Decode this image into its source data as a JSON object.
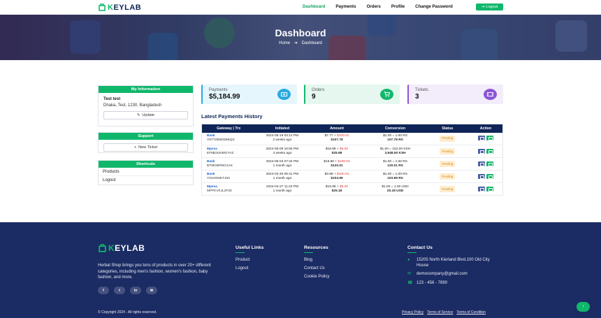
{
  "brand": {
    "name_k": "K",
    "name_rest": "EYLAB"
  },
  "nav": {
    "items": [
      {
        "label": "Dashboard",
        "active": true
      },
      {
        "label": "Payments",
        "active": false
      },
      {
        "label": "Orders",
        "active": false
      },
      {
        "label": "Profile",
        "active": false
      },
      {
        "label": "Change Password",
        "active": false
      }
    ],
    "logout_label": "Logout"
  },
  "banner": {
    "title": "Dashboard",
    "breadcrumb_home": "Home",
    "breadcrumb_current": "Dashboard"
  },
  "sidebar": {
    "info_title": "My Information",
    "user_name": "Test test",
    "user_address": "Dhaka, Test, 1230, Bangladesh",
    "update_label": "Update",
    "support_title": "Support",
    "new_ticket_label": "New Ticket",
    "shortcuts_title": "Shortcuts",
    "shortcuts": [
      "Products",
      "Logout"
    ]
  },
  "stats": [
    {
      "label": "Payments",
      "value": "$5,184.99",
      "bg": "#e6f6fd",
      "border": "#2aa9e0",
      "icon_bg": "#2aa9e0",
      "icon": "money-icon"
    },
    {
      "label": "Orders",
      "value": "9",
      "bg": "#e5f7ef",
      "border": "#10b76b",
      "icon_bg": "#10b76b",
      "icon": "cart-icon"
    },
    {
      "label": "Tickets",
      "value": "3",
      "bg": "#f2ecfb",
      "border": "#8a55d6",
      "icon_bg": "#8a55d6",
      "icon": "ticket-icon"
    }
  ],
  "payments": {
    "title": "Latest Payments History",
    "columns": [
      "Gateway | Trx",
      "Initiated",
      "Amount",
      "Conversion",
      "Status",
      "Action"
    ],
    "rows": [
      {
        "gateway": "Bank",
        "trx": "V5TTZ86DD6EQS",
        "date": "2024-05-19 03:14 PM",
        "ago": "2 weeks ago",
        "amt_base": "$7.77 + ",
        "amt_fee": "$100.01",
        "amt_total": "$107.78",
        "conv": "$1.00 = 1.00 RS",
        "conv_total": "107.78 RS",
        "status": "Pending"
      },
      {
        "gateway": "Mpesa",
        "trx": "EF8B3UNMGYAZ",
        "date": "2024-05-09 10:55 PM",
        "ago": "4 weeks ago",
        "amt_base": "$19.98 + ",
        "amt_fee": "$6.00",
        "amt_total": "$25.98",
        "conv": "$1.00 = 152.00 KSH",
        "conv_total": "3,948.50 KSH",
        "status": "Pending"
      },
      {
        "gateway": "Bank",
        "trx": "BT8K95RNG1AK",
        "date": "2024-05-03 07:34 PM",
        "ago": "1 month ago",
        "amt_base": "$19.98 + ",
        "amt_fee": "$100.03",
        "amt_total": "$120.01",
        "conv": "$1.00 = 1.00 RS",
        "conv_total": "120.01 RS",
        "status": "Pending"
      },
      {
        "gateway": "Bank",
        "trx": "YGH25SETJ53",
        "date": "2024-04-30 06:41 PM",
        "ago": "1 month ago",
        "amt_base": "$3.98 + ",
        "amt_fee": "$100.01",
        "amt_total": "$103.99",
        "conv": "$1.00 = 1.00 RS",
        "conv_total": "103.99 RS",
        "status": "Pending"
      },
      {
        "gateway": "Mpesa",
        "trx": "MPFKVKJL2F20",
        "date": "2024-04-27 11:23 PM",
        "ago": "1 month ago",
        "amt_base": "$19.98 + ",
        "amt_fee": "$5.20",
        "amt_total": "$25.18",
        "conv": "$1.00 = 1.00 USD",
        "conv_total": "25.18 USD",
        "status": "Pending"
      }
    ]
  },
  "footer": {
    "description": "Herbal Shop brings you tons of products in over 20+ different categories, including men's fashion, women's fashion, baby fashion, and more.",
    "social": [
      "f",
      "t",
      "in",
      "✉"
    ],
    "useful_links_title": "Useful Links",
    "useful_links": [
      "Product",
      "Logout"
    ],
    "resources_title": "Resources",
    "resources": [
      "Blog",
      "Contact Us",
      "Cookie Policy"
    ],
    "contact_title": "Contact Us",
    "address": "15205 North Kierland Blvd.100 Old City House",
    "email": "democompany@gmail.com",
    "phone": "123 - 456 - 7890",
    "copyright": "© Copyright 2024 . All rights reserved.",
    "legal": [
      "Privacy Policy",
      "Terms of Service",
      "Terms of Condition"
    ]
  }
}
